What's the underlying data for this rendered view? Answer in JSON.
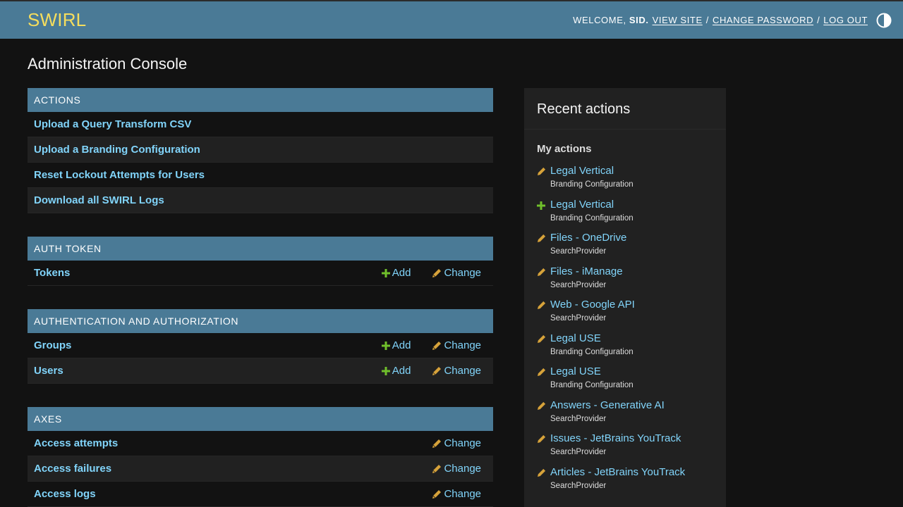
{
  "header": {
    "brand": "SWIRL",
    "welcome": "WELCOME,",
    "username": "SID.",
    "view_site": "VIEW SITE",
    "change_password": "CHANGE PASSWORD",
    "log_out": "LOG OUT",
    "separator": "/",
    "theme_icon": "half-circle-icon"
  },
  "page": {
    "title": "Administration Console"
  },
  "modules": {
    "actions": {
      "caption": "ACTIONS",
      "items": [
        "Upload a Query Transform CSV",
        "Upload a Branding Configuration",
        "Reset Lockout Attempts for Users",
        "Download all SWIRL Logs"
      ]
    },
    "auth_token": {
      "caption": "AUTH TOKEN",
      "rows": [
        {
          "name": "Tokens"
        }
      ]
    },
    "authn": {
      "caption": "AUTHENTICATION AND AUTHORIZATION",
      "rows": [
        {
          "name": "Groups"
        },
        {
          "name": "Users"
        }
      ]
    },
    "axes": {
      "caption": "AXES",
      "rows": [
        {
          "name": "Access attempts"
        },
        {
          "name": "Access failures"
        },
        {
          "name": "Access logs"
        }
      ]
    }
  },
  "labels": {
    "add": "Add",
    "change": "Change"
  },
  "icons": {
    "add": "plus-icon",
    "change": "pencil-icon"
  },
  "colors": {
    "header_bg": "#4a7a96",
    "brand": "#f5dd5d",
    "link": "#81d4fa",
    "add_icon": "#70bf2b",
    "change_icon": "#d6a23a"
  },
  "recent": {
    "title": "Recent actions",
    "subtitle": "My actions",
    "items": [
      {
        "name": "Legal Vertical",
        "type": "Branding Configuration",
        "icon": "pencil-icon"
      },
      {
        "name": "Legal Vertical",
        "type": "Branding Configuration",
        "icon": "plus-icon"
      },
      {
        "name": "Files - OneDrive",
        "type": "SearchProvider",
        "icon": "pencil-icon"
      },
      {
        "name": "Files - iManage",
        "type": "SearchProvider",
        "icon": "pencil-icon"
      },
      {
        "name": "Web - Google API",
        "type": "SearchProvider",
        "icon": "pencil-icon"
      },
      {
        "name": "Legal USE",
        "type": "Branding Configuration",
        "icon": "pencil-icon"
      },
      {
        "name": "Legal USE",
        "type": "Branding Configuration",
        "icon": "pencil-icon"
      },
      {
        "name": "Answers - Generative AI",
        "type": "SearchProvider",
        "icon": "pencil-icon"
      },
      {
        "name": "Issues - JetBrains YouTrack",
        "type": "SearchProvider",
        "icon": "pencil-icon"
      },
      {
        "name": "Articles - JetBrains YouTrack",
        "type": "SearchProvider",
        "icon": "pencil-icon"
      }
    ]
  }
}
